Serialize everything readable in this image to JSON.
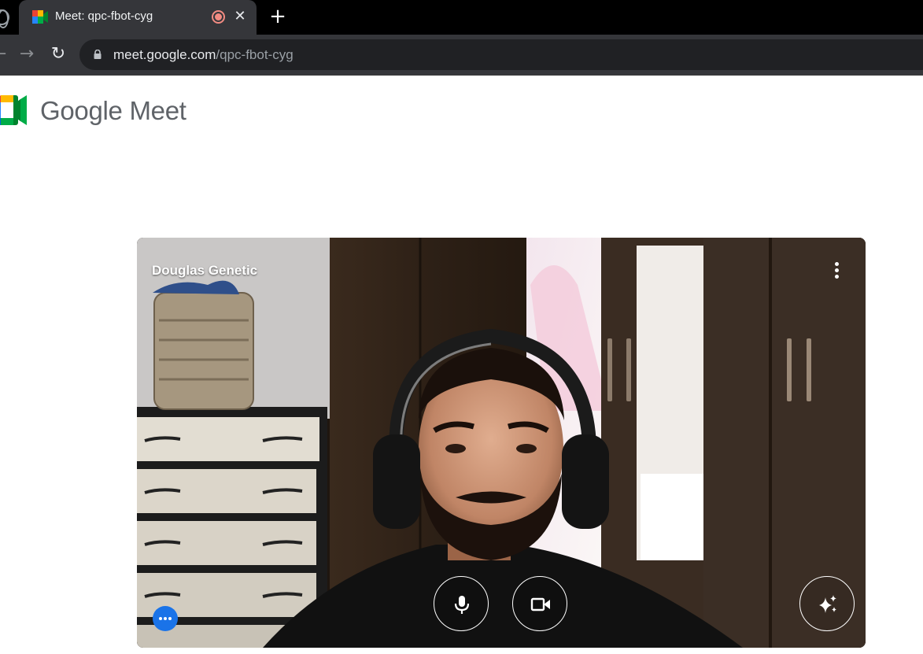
{
  "browser": {
    "tab_title": "Meet: qpc-fbot-cyg",
    "tab_close": "✕",
    "new_tab": "+",
    "url_host": "meet.google.com",
    "url_path": "/qpc-fbot-cyg",
    "nav_back": "←",
    "nav_forward": "→",
    "nav_reload": "↻"
  },
  "header": {
    "brand": "Google Meet"
  },
  "preview": {
    "participant_name": "Douglas Genetic"
  },
  "icons": {
    "globe": "globe-icon",
    "favicon": "google-meet-icon",
    "recording": "recording-indicator-icon",
    "lock": "lock-icon",
    "more": "more-vertical-icon",
    "mic": "microphone-icon",
    "camera": "video-camera-icon",
    "effects": "sparkle-effects-icon",
    "dots": "more-horizontal-icon"
  },
  "colors": {
    "tab_bar": "#000000",
    "active_tab": "#35363a",
    "omnibox": "#202124",
    "recording": "#f28b82",
    "wordmark": "#5f6368",
    "accent_blue": "#1a73e8",
    "meet_green": "#00832d",
    "meet_yellow": "#ffba00",
    "meet_red": "#ea4335"
  }
}
